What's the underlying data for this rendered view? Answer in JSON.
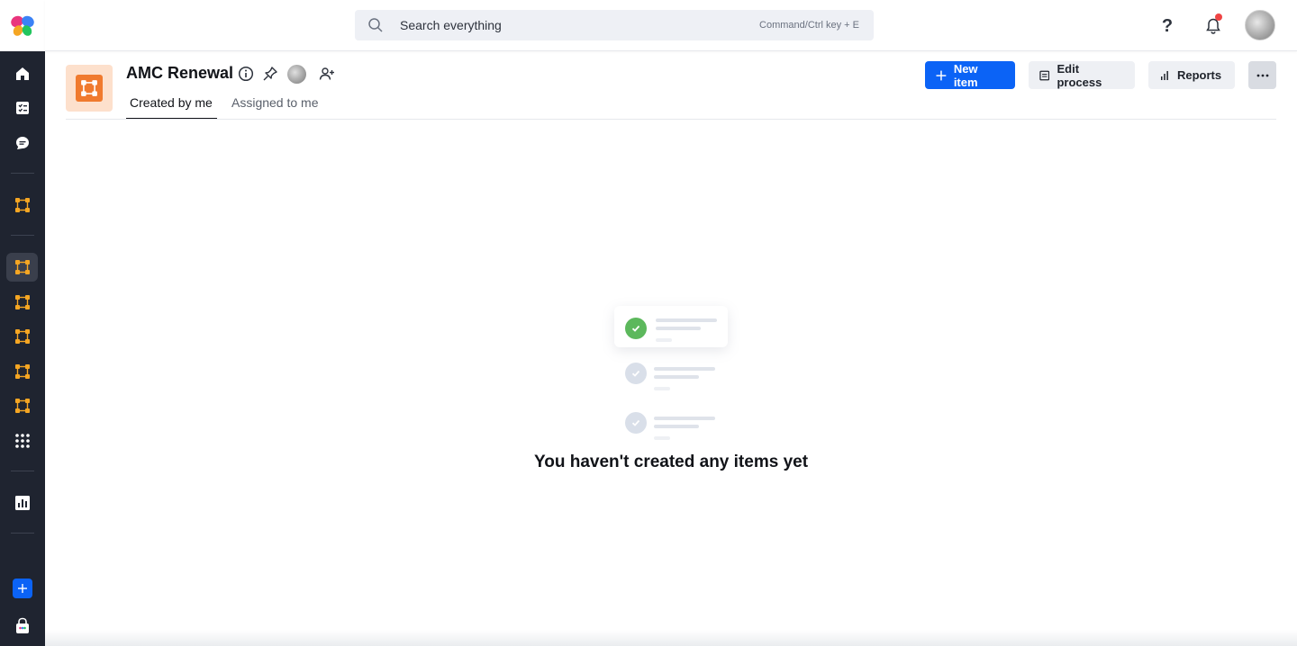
{
  "search": {
    "placeholder": "Search everything",
    "shortcut": "Command/Ctrl key + E"
  },
  "header": {
    "title": "AMC Renewal"
  },
  "tabs": [
    {
      "label": "Created by me",
      "active": true
    },
    {
      "label": "Assigned to me",
      "active": false
    }
  ],
  "actions": {
    "new_item": "New item",
    "edit_process": "Edit process",
    "reports": "Reports"
  },
  "empty_state": {
    "message": "You haven't created any items yet"
  },
  "help": {
    "label": "?"
  },
  "colors": {
    "accent": "#0b63f6",
    "process": "#f07a2e",
    "rail": "#1f2430",
    "process_icon": "#f5a623"
  }
}
